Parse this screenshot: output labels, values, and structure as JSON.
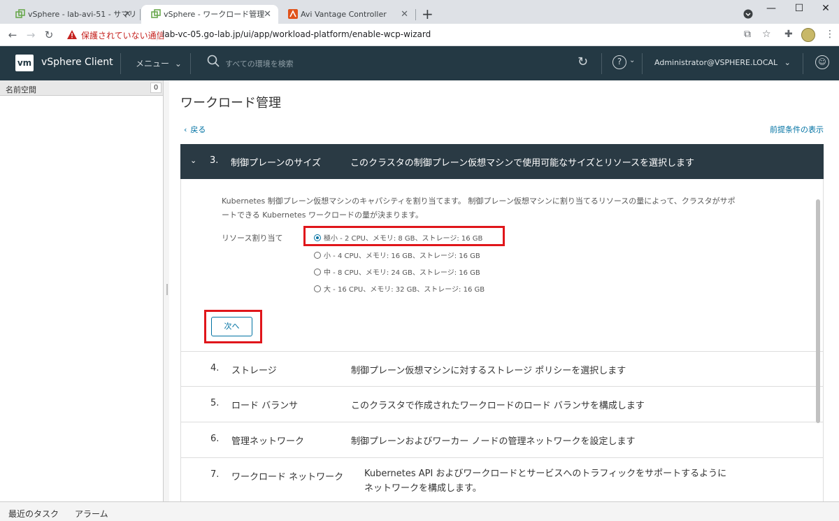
{
  "browser": {
    "tabs": [
      {
        "title": "vSphere - lab-avi-51 - サマリ",
        "active": false
      },
      {
        "title": "vSphere - ワークロード管理",
        "active": true
      },
      {
        "title": "Avi Vantage Controller",
        "active": false
      }
    ],
    "tab_close_glyph": "✕",
    "new_tab_glyph": "+",
    "window_controls": [
      "—",
      "☐",
      "✕"
    ],
    "security_warning": "保護されていない通信",
    "url": "lab-vc-05.go-lab.jp/ui/app/workload-platform/enable-wcp-wizard"
  },
  "header": {
    "logo": "vm",
    "app_title": "vSphere Client",
    "menu_label": "メニュー",
    "search_placeholder": "すべての環境を検索",
    "user": "Administrator@VSPHERE.LOCAL"
  },
  "left_panel": {
    "title": "名前空間",
    "count": "0"
  },
  "main": {
    "page_title": "ワークロード管理",
    "back_link": "戻る",
    "prereq_link": "前提条件の表示",
    "active_step": {
      "number": "3.",
      "name": "制御プレーンのサイズ",
      "description": "このクラスタの制御プレーン仮想マシンで使用可能なサイズとリソースを選択します",
      "intro_line1": "Kubernetes 制御プレーン仮想マシンのキャパシティを割り当てます。 制御プレーン仮想マシンに割り当てるリソースの量によって、クラスタがサポ",
      "intro_line2": "ートできる Kubernetes ワークロードの量が決まります。",
      "resource_label": "リソース割り当て",
      "options": [
        {
          "label": "極小 - 2 CPU、メモリ: 8 GB、ストレージ: 16 GB",
          "selected": true
        },
        {
          "label": "小 - 4 CPU、メモリ: 16 GB、ストレージ: 16 GB",
          "selected": false
        },
        {
          "label": "中 - 8 CPU、メモリ: 24 GB、ストレージ: 16 GB",
          "selected": false
        },
        {
          "label": "大 - 16 CPU、メモリ: 32 GB、ストレージ: 16 GB",
          "selected": false
        }
      ],
      "next_button": "次へ"
    },
    "steps": [
      {
        "number": "4.",
        "name": "ストレージ",
        "description": "制御プレーン仮想マシンに対するストレージ ポリシーを選択します"
      },
      {
        "number": "5.",
        "name": "ロード バランサ",
        "description": "このクラスタで作成されたワークロードのロード バランサを構成します"
      },
      {
        "number": "6.",
        "name": "管理ネットワーク",
        "description": "制御プレーンおよびワーカー ノードの管理ネットワークを設定します"
      },
      {
        "number": "7.",
        "name": "ワークロード ネットワーク",
        "description_line1": "Kubernetes API およびワークロードとサービスへのトラフィックをサポートするように",
        "description_line2": "ネットワークを構成します。"
      }
    ]
  },
  "bottom_bar": {
    "recent_tasks": "最近のタスク",
    "alarms": "アラーム"
  },
  "colors": {
    "header_bg": "#243944",
    "active_step_bg": "#2a3a44",
    "link": "#0072a3",
    "highlight": "#e0161b"
  }
}
